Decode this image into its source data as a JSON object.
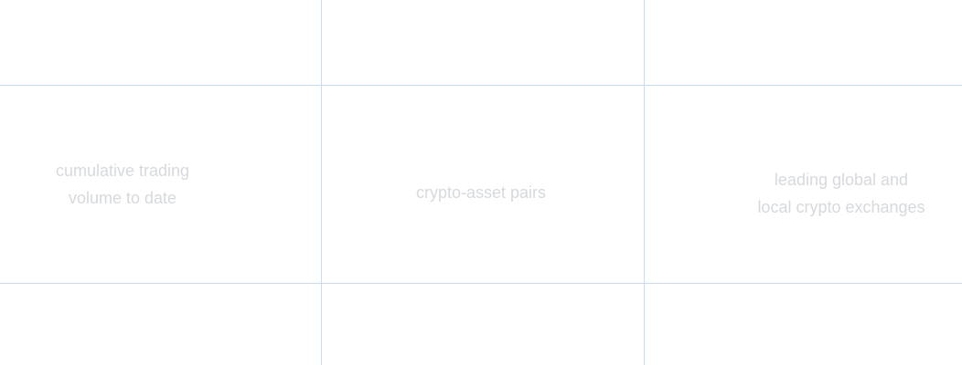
{
  "stats": [
    {
      "label_lines": [
        "cumulative trading",
        "volume to date"
      ]
    },
    {
      "label_lines": [
        "crypto-asset pairs"
      ]
    },
    {
      "label_lines": [
        "leading global and",
        "local crypto exchanges"
      ]
    }
  ],
  "colors": {
    "grid_line": "#c9dcf3",
    "label_text": "#d6d9dd",
    "background": "#ffffff"
  }
}
